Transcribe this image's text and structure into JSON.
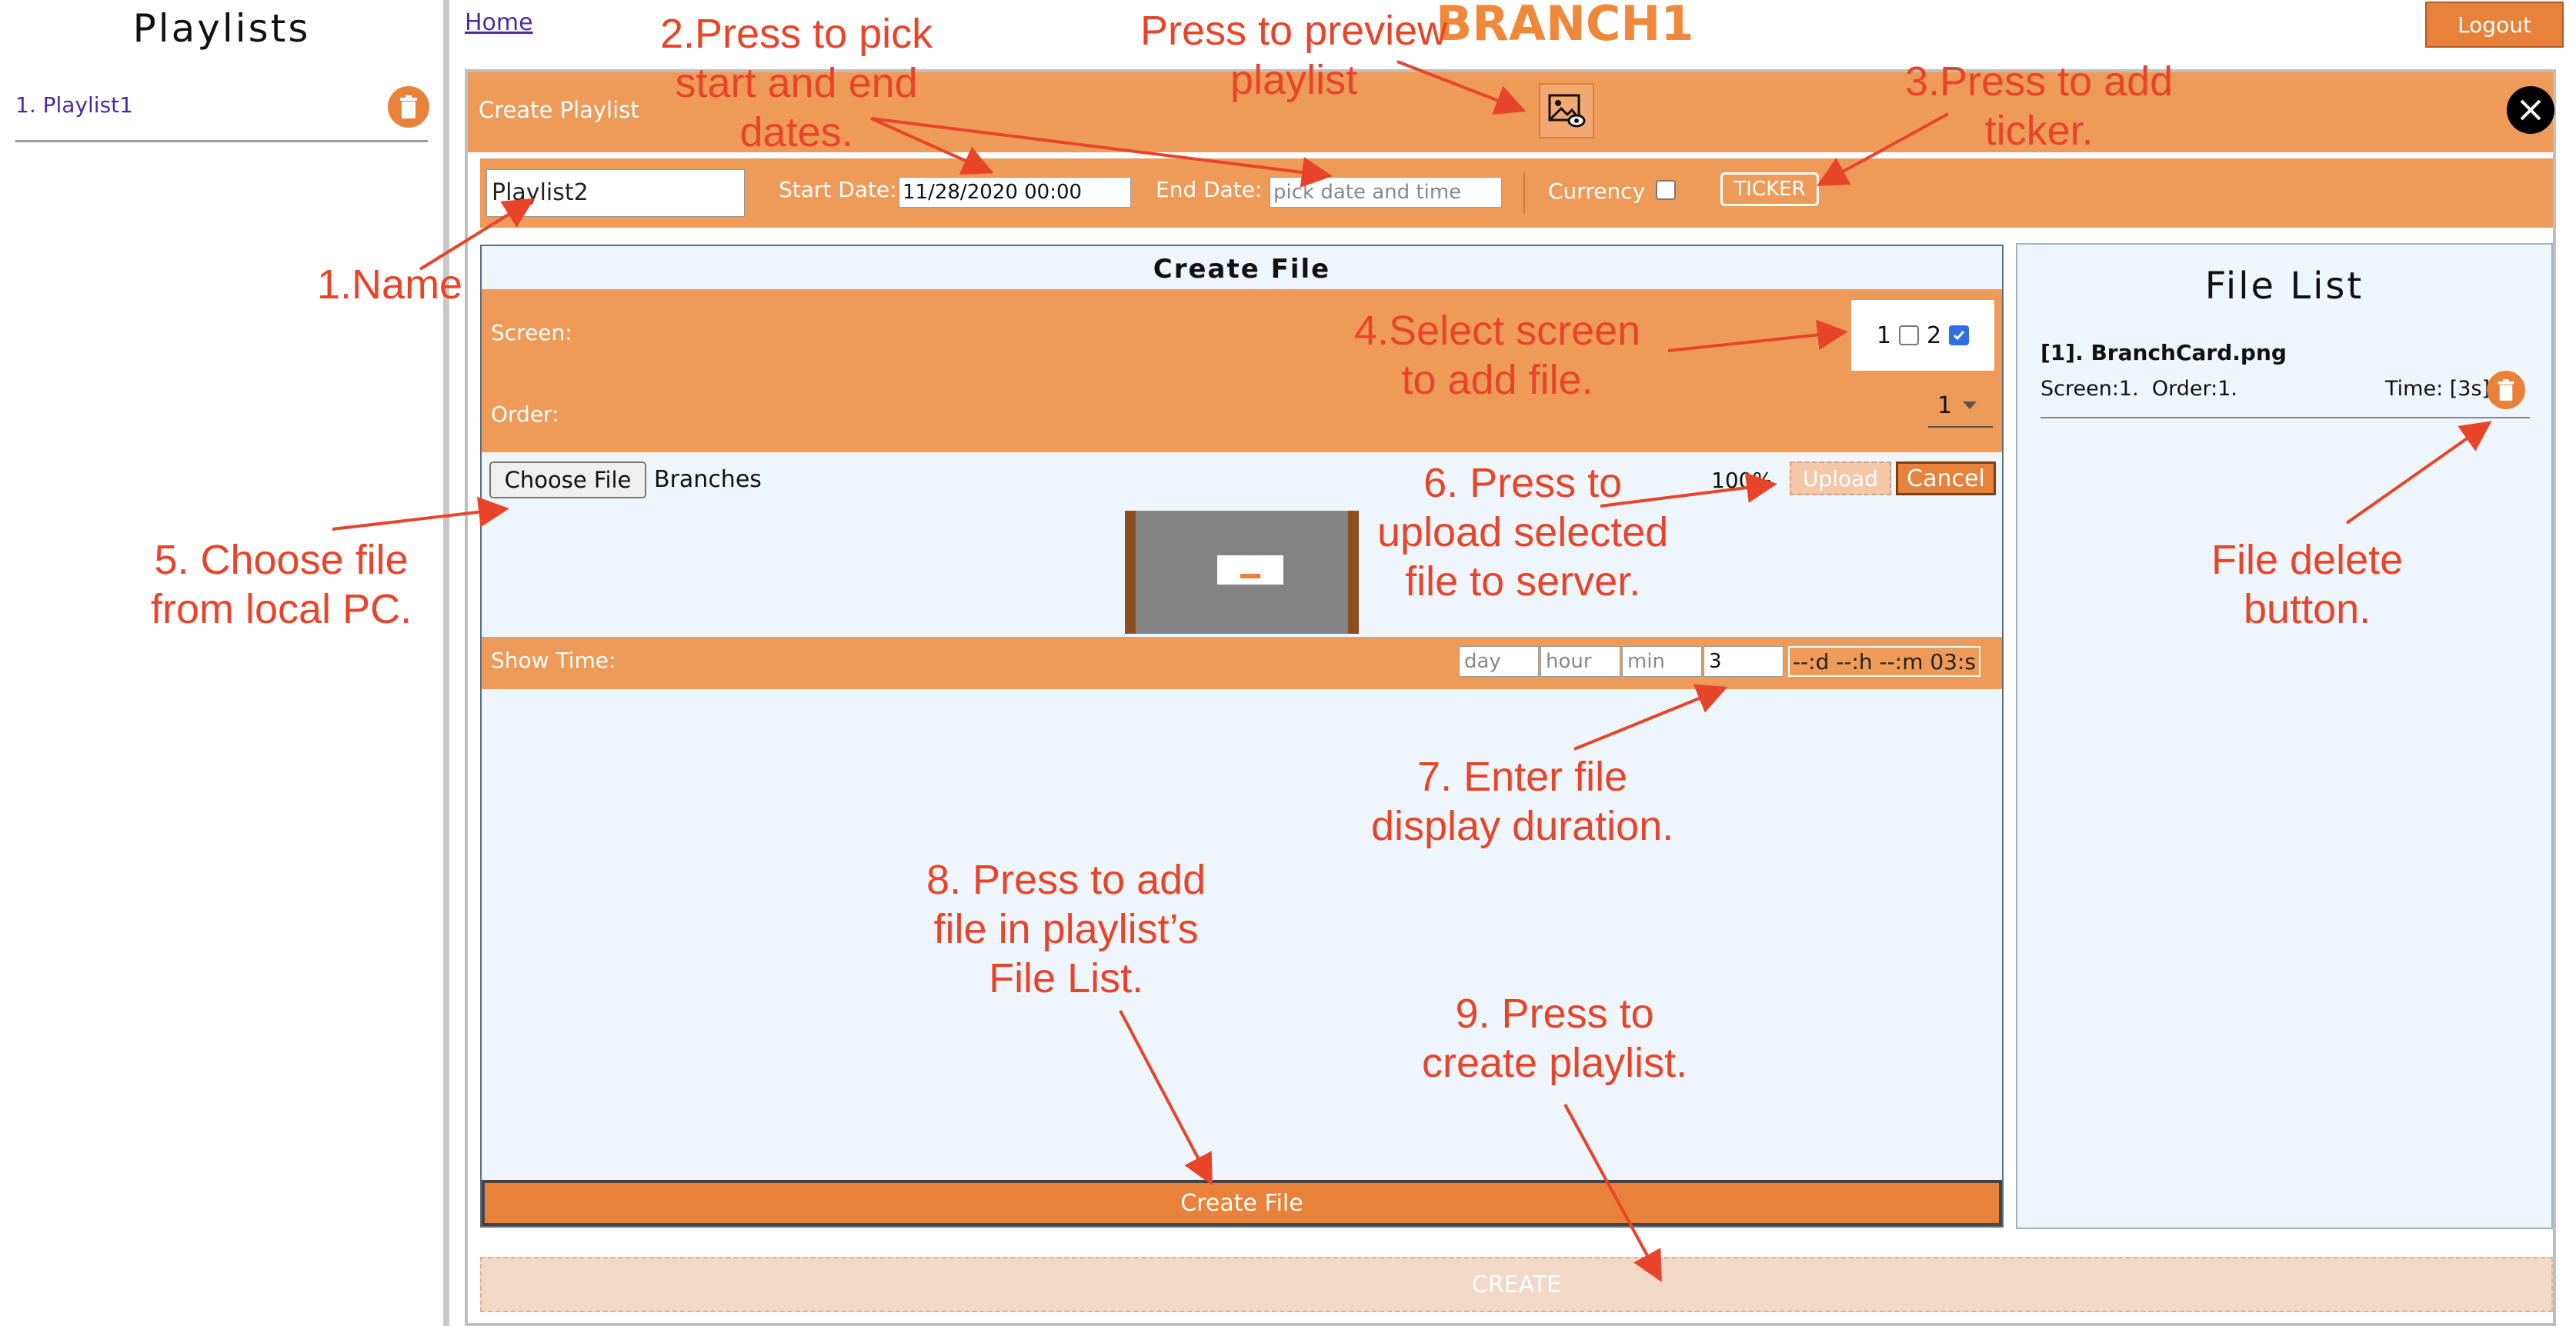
{
  "sidebar": {
    "title": "Playlists",
    "items": [
      {
        "label": "1. Playlist1"
      }
    ]
  },
  "topbar": {
    "home_link": "Home",
    "branch_title": "BRANCH1",
    "logout_label": "Logout"
  },
  "dialog": {
    "title": "Create Playlist",
    "name_value": "Playlist2",
    "start_label": "Start Date:",
    "start_value": "11/28/2020 00:00",
    "end_label": "End Date:",
    "end_placeholder": "pick date and time",
    "currency_label": "Currency",
    "ticker_label": "TICKER"
  },
  "create_file": {
    "title": "Create File",
    "screen_label": "Screen:",
    "screens": [
      {
        "label": "1",
        "checked": false
      },
      {
        "label": "2",
        "checked": true
      }
    ],
    "order_label": "Order:",
    "order_value": "1",
    "choose_file_label": "Choose File",
    "file_name": "Branches",
    "upload_progress": "100%",
    "upload_label": "Upload",
    "cancel_label": "Cancel",
    "show_time_label": "Show Time:",
    "day_placeholder": "day",
    "hour_placeholder": "hour",
    "min_placeholder": "min",
    "sec_value": "3",
    "time_display": "--:d --:h --:m 03:s",
    "create_file_label": "Create File"
  },
  "file_list": {
    "title": "File List",
    "items": [
      {
        "name": "[1]. BranchCard.png",
        "meta": "Screen:1.  Order:1.",
        "time": "Time: [3s]."
      }
    ]
  },
  "create_label": "CREATE",
  "annotations": {
    "name": "1.Name",
    "dates": "2.Press to pick\nstart and end\ndates.",
    "preview": "Press to preview\nplaylist",
    "ticker": "3.Press to add\nticker.",
    "screen": "4.Select screen\nto add file.",
    "choose": "5. Choose file\nfrom local PC.",
    "upload": "6. Press to\nupload selected\nfile to server.",
    "duration": "7. Enter file\ndisplay duration.",
    "add_file": "8. Press to add\nfile in playlist’s\nFile List.",
    "create": "9. Press to\ncreate playlist.",
    "delete": "File delete\nbutton."
  },
  "colors": {
    "accent": "#ee9b5a",
    "button": "#e8823a",
    "annotation": "#e8442a",
    "panel": "#eef6fb"
  }
}
